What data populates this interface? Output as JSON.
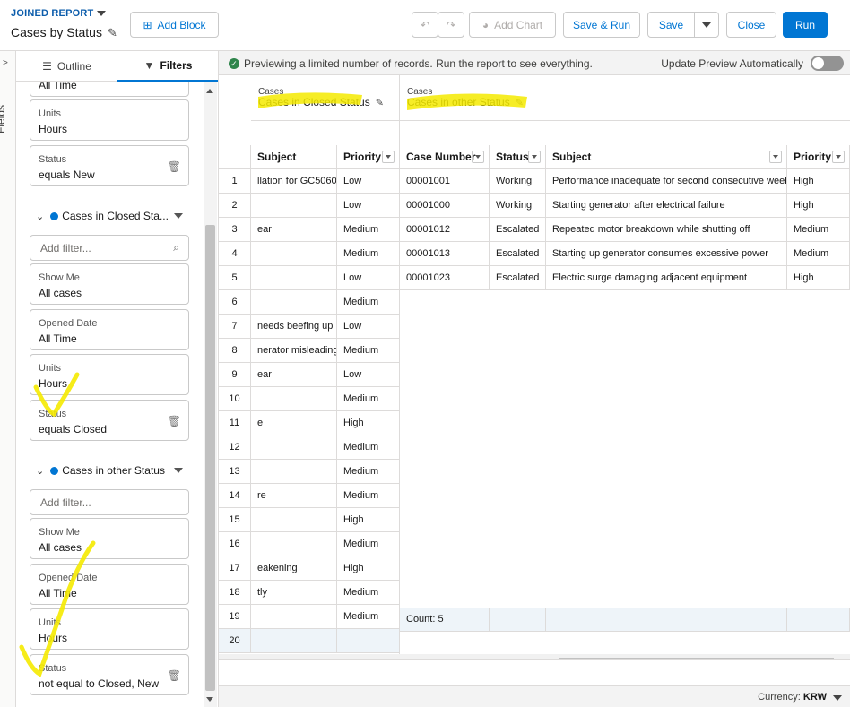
{
  "header": {
    "report_type": "JOINED REPORT",
    "title": "Cases by Status",
    "buttons": {
      "add_block": "Add Block",
      "add_chart": "Add Chart",
      "save_run": "Save & Run",
      "save": "Save",
      "close": "Close",
      "run": "Run"
    }
  },
  "sidebar_strip": {
    "label": "Fields"
  },
  "panel": {
    "tabs": {
      "outline": "Outline",
      "filters": "Filters"
    },
    "top_cards": [
      {
        "key": "",
        "value": "All Time"
      },
      {
        "key": "Units",
        "value": "Hours"
      },
      {
        "key": "Status",
        "value": "equals New"
      }
    ],
    "group1": {
      "name": "Cases in Closed Sta...",
      "add_filter_placeholder": "Add filter...",
      "cards": [
        {
          "key": "Show Me",
          "value": "All cases"
        },
        {
          "key": "Opened Date",
          "value": "All Time"
        },
        {
          "key": "Units",
          "value": "Hours"
        },
        {
          "key": "Status",
          "value": "equals Closed"
        }
      ]
    },
    "group2": {
      "name": "Cases in other Status",
      "add_filter_placeholder": "Add filter...",
      "cards": [
        {
          "key": "Show Me",
          "value": "All cases"
        },
        {
          "key": "Opened Date",
          "value": "All Time"
        },
        {
          "key": "Units",
          "value": "Hours"
        },
        {
          "key": "Status",
          "value": "not equal to Closed, New"
        }
      ]
    }
  },
  "notice": {
    "message": "Previewing a limited number of records. Run the report to see everything.",
    "update_label": "Update Preview Automatically"
  },
  "blocks": {
    "left": {
      "small": "Cases",
      "title": "Cases in Closed Status"
    },
    "right": {
      "small": "Cases",
      "title": "Cases in other Status"
    }
  },
  "columns": {
    "left": [
      "Subject",
      "Priority"
    ],
    "right": [
      "Case Number",
      "Status",
      "Subject",
      "Priority"
    ]
  },
  "left_rows": [
    {
      "n": "1",
      "subject": "llation for GC5060",
      "priority": "Low"
    },
    {
      "n": "2",
      "subject": "",
      "priority": "Low"
    },
    {
      "n": "3",
      "subject": "ear",
      "priority": "Medium"
    },
    {
      "n": "4",
      "subject": "",
      "priority": "Medium"
    },
    {
      "n": "5",
      "subject": "",
      "priority": "Low"
    },
    {
      "n": "6",
      "subject": "",
      "priority": "Medium"
    },
    {
      "n": "7",
      "subject": "needs beefing up",
      "priority": "Low"
    },
    {
      "n": "8",
      "subject": "nerator misleading",
      "priority": "Medium"
    },
    {
      "n": "9",
      "subject": "ear",
      "priority": "Low"
    },
    {
      "n": "10",
      "subject": "",
      "priority": "Medium"
    },
    {
      "n": "11",
      "subject": "e",
      "priority": "High"
    },
    {
      "n": "12",
      "subject": "",
      "priority": "Medium"
    },
    {
      "n": "13",
      "subject": "",
      "priority": "Medium"
    },
    {
      "n": "14",
      "subject": "re",
      "priority": "Medium"
    },
    {
      "n": "15",
      "subject": "",
      "priority": "High"
    },
    {
      "n": "16",
      "subject": "",
      "priority": "Medium"
    },
    {
      "n": "17",
      "subject": "eakening",
      "priority": "High"
    },
    {
      "n": "18",
      "subject": "tly",
      "priority": "Medium"
    },
    {
      "n": "19",
      "subject": "",
      "priority": "Medium"
    },
    {
      "n": "20",
      "subject": "",
      "priority": ""
    }
  ],
  "right_rows": [
    {
      "case": "00001001",
      "status": "Working",
      "subject": "Performance inadequate for second consecutive week",
      "priority": "High"
    },
    {
      "case": "00001000",
      "status": "Working",
      "subject": "Starting generator after electrical failure",
      "priority": "High"
    },
    {
      "case": "00001012",
      "status": "Escalated",
      "subject": "Repeated motor breakdown while shutting off",
      "priority": "Medium"
    },
    {
      "case": "00001013",
      "status": "Escalated",
      "subject": "Starting up generator consumes excessive power",
      "priority": "Medium"
    },
    {
      "case": "00001023",
      "status": "Escalated",
      "subject": "Electric surge damaging adjacent equipment",
      "priority": "High"
    }
  ],
  "right_summary": "Count: 5",
  "footer": {
    "currency_label": "Currency:",
    "currency": "KRW"
  },
  "colors": {
    "brand": "#0176d3",
    "highlight": "#f5ea00"
  }
}
